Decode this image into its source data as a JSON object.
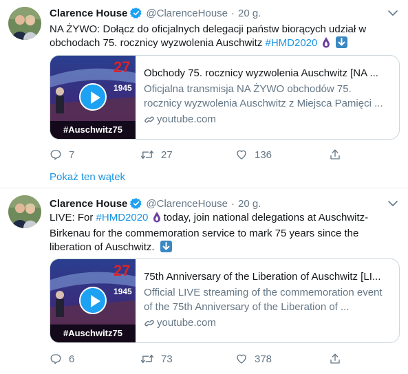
{
  "tweets": [
    {
      "author": "Clarence House",
      "handle": "@ClarenceHouse",
      "separator": "·",
      "time": "20 g.",
      "text_before": "NA ŻYWO: Dołącz do oficjalnych delegacji państw biorących udział w obchodach 75. rocznicy wyzwolenia Auschwitz ",
      "hashtag": "#HMD2020",
      "text_after": "",
      "card": {
        "thumb_number": "27",
        "thumb_year": "1945",
        "thumb_tag": "#Auschwitz75",
        "title": "Obchody 75. rocznicy wyzwolenia Auschwitz [NA ...",
        "description": "Oficjalna transmisja NA ŻYWO obchodów 75. rocznicy wyzwolenia Auschwitz z Miejsca Pamięci ...",
        "domain": "youtube.com"
      },
      "replies": "7",
      "retweets": "27",
      "likes": "136",
      "show_thread": "Pokaż ten wątek"
    },
    {
      "author": "Clarence House",
      "handle": "@ClarenceHouse",
      "separator": "·",
      "time": "20 g.",
      "text_before": "LIVE: For ",
      "hashtag": "#HMD2020",
      "text_after": " today, join national delegations at Auschwitz-Birkenau for the commemoration service to mark 75 years since the liberation of Auschwitz.",
      "card": {
        "thumb_number": "27",
        "thumb_year": "1945",
        "thumb_tag": "#Auschwitz75",
        "title": "75th Anniversary of the Liberation of Auschwitz [LI...",
        "description": "Official LIVE streaming of the commemoration event of the 75th Anniversary of the Liberation of ...",
        "domain": "youtube.com"
      },
      "replies": "6",
      "retweets": "73",
      "likes": "378"
    }
  ],
  "icons": {
    "verified": "verified-badge-icon",
    "caret": "chevron-down-icon",
    "reply": "reply-icon",
    "retweet": "retweet-icon",
    "like": "heart-icon",
    "share": "share-icon",
    "link": "link-icon",
    "candle": "candle-emoji-icon",
    "down_arrow": "down-arrow-emoji-icon"
  },
  "colors": {
    "link": "#1b95e0",
    "verified": "#1da1f2",
    "muted": "#657786",
    "border": "#e6ecf0"
  }
}
